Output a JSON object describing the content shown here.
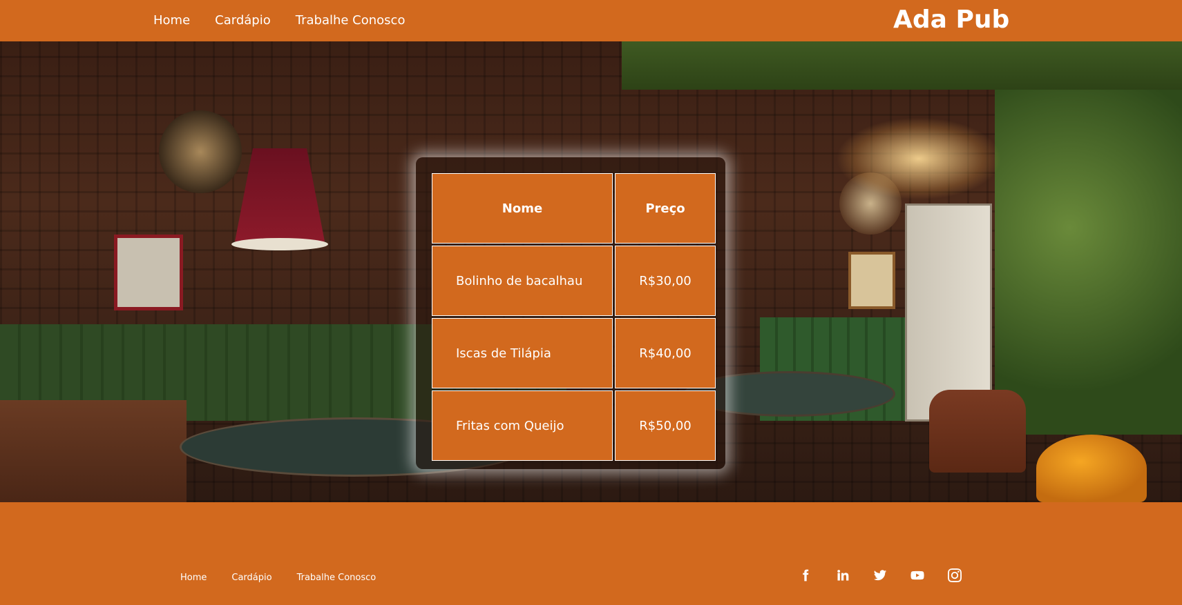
{
  "header": {
    "nav": [
      {
        "label": "Home"
      },
      {
        "label": "Cardápio"
      },
      {
        "label": "Trabalhe Conosco"
      }
    ],
    "brand": "Ada Pub"
  },
  "menu": {
    "columns": [
      "Nome",
      "Preço"
    ],
    "rows": [
      {
        "name": "Bolinho de bacalhau",
        "price": "R$30,00"
      },
      {
        "name": "Iscas de Tilápia",
        "price": "R$40,00"
      },
      {
        "name": "Fritas com Queijo",
        "price": "R$50,00"
      }
    ]
  },
  "footer": {
    "nav": [
      {
        "label": "Home"
      },
      {
        "label": "Cardápio"
      },
      {
        "label": "Trabalhe Conosco"
      }
    ],
    "social": [
      "facebook-icon",
      "linkedin-icon",
      "twitter-icon",
      "youtube-icon",
      "instagram-icon"
    ]
  },
  "colors": {
    "accent": "#d2691e",
    "text": "#ffffff"
  }
}
